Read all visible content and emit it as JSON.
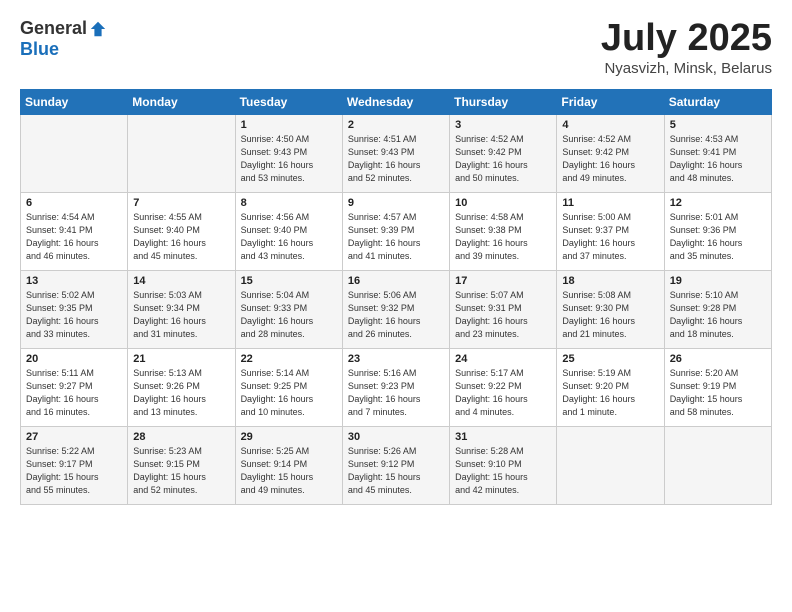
{
  "header": {
    "logo_general": "General",
    "logo_blue": "Blue",
    "title": "July 2025",
    "location": "Nyasvizh, Minsk, Belarus"
  },
  "days_of_week": [
    "Sunday",
    "Monday",
    "Tuesday",
    "Wednesday",
    "Thursday",
    "Friday",
    "Saturday"
  ],
  "weeks": [
    [
      {
        "day": "",
        "info": ""
      },
      {
        "day": "",
        "info": ""
      },
      {
        "day": "1",
        "info": "Sunrise: 4:50 AM\nSunset: 9:43 PM\nDaylight: 16 hours\nand 53 minutes."
      },
      {
        "day": "2",
        "info": "Sunrise: 4:51 AM\nSunset: 9:43 PM\nDaylight: 16 hours\nand 52 minutes."
      },
      {
        "day": "3",
        "info": "Sunrise: 4:52 AM\nSunset: 9:42 PM\nDaylight: 16 hours\nand 50 minutes."
      },
      {
        "day": "4",
        "info": "Sunrise: 4:52 AM\nSunset: 9:42 PM\nDaylight: 16 hours\nand 49 minutes."
      },
      {
        "day": "5",
        "info": "Sunrise: 4:53 AM\nSunset: 9:41 PM\nDaylight: 16 hours\nand 48 minutes."
      }
    ],
    [
      {
        "day": "6",
        "info": "Sunrise: 4:54 AM\nSunset: 9:41 PM\nDaylight: 16 hours\nand 46 minutes."
      },
      {
        "day": "7",
        "info": "Sunrise: 4:55 AM\nSunset: 9:40 PM\nDaylight: 16 hours\nand 45 minutes."
      },
      {
        "day": "8",
        "info": "Sunrise: 4:56 AM\nSunset: 9:40 PM\nDaylight: 16 hours\nand 43 minutes."
      },
      {
        "day": "9",
        "info": "Sunrise: 4:57 AM\nSunset: 9:39 PM\nDaylight: 16 hours\nand 41 minutes."
      },
      {
        "day": "10",
        "info": "Sunrise: 4:58 AM\nSunset: 9:38 PM\nDaylight: 16 hours\nand 39 minutes."
      },
      {
        "day": "11",
        "info": "Sunrise: 5:00 AM\nSunset: 9:37 PM\nDaylight: 16 hours\nand 37 minutes."
      },
      {
        "day": "12",
        "info": "Sunrise: 5:01 AM\nSunset: 9:36 PM\nDaylight: 16 hours\nand 35 minutes."
      }
    ],
    [
      {
        "day": "13",
        "info": "Sunrise: 5:02 AM\nSunset: 9:35 PM\nDaylight: 16 hours\nand 33 minutes."
      },
      {
        "day": "14",
        "info": "Sunrise: 5:03 AM\nSunset: 9:34 PM\nDaylight: 16 hours\nand 31 minutes."
      },
      {
        "day": "15",
        "info": "Sunrise: 5:04 AM\nSunset: 9:33 PM\nDaylight: 16 hours\nand 28 minutes."
      },
      {
        "day": "16",
        "info": "Sunrise: 5:06 AM\nSunset: 9:32 PM\nDaylight: 16 hours\nand 26 minutes."
      },
      {
        "day": "17",
        "info": "Sunrise: 5:07 AM\nSunset: 9:31 PM\nDaylight: 16 hours\nand 23 minutes."
      },
      {
        "day": "18",
        "info": "Sunrise: 5:08 AM\nSunset: 9:30 PM\nDaylight: 16 hours\nand 21 minutes."
      },
      {
        "day": "19",
        "info": "Sunrise: 5:10 AM\nSunset: 9:28 PM\nDaylight: 16 hours\nand 18 minutes."
      }
    ],
    [
      {
        "day": "20",
        "info": "Sunrise: 5:11 AM\nSunset: 9:27 PM\nDaylight: 16 hours\nand 16 minutes."
      },
      {
        "day": "21",
        "info": "Sunrise: 5:13 AM\nSunset: 9:26 PM\nDaylight: 16 hours\nand 13 minutes."
      },
      {
        "day": "22",
        "info": "Sunrise: 5:14 AM\nSunset: 9:25 PM\nDaylight: 16 hours\nand 10 minutes."
      },
      {
        "day": "23",
        "info": "Sunrise: 5:16 AM\nSunset: 9:23 PM\nDaylight: 16 hours\nand 7 minutes."
      },
      {
        "day": "24",
        "info": "Sunrise: 5:17 AM\nSunset: 9:22 PM\nDaylight: 16 hours\nand 4 minutes."
      },
      {
        "day": "25",
        "info": "Sunrise: 5:19 AM\nSunset: 9:20 PM\nDaylight: 16 hours\nand 1 minute."
      },
      {
        "day": "26",
        "info": "Sunrise: 5:20 AM\nSunset: 9:19 PM\nDaylight: 15 hours\nand 58 minutes."
      }
    ],
    [
      {
        "day": "27",
        "info": "Sunrise: 5:22 AM\nSunset: 9:17 PM\nDaylight: 15 hours\nand 55 minutes."
      },
      {
        "day": "28",
        "info": "Sunrise: 5:23 AM\nSunset: 9:15 PM\nDaylight: 15 hours\nand 52 minutes."
      },
      {
        "day": "29",
        "info": "Sunrise: 5:25 AM\nSunset: 9:14 PM\nDaylight: 15 hours\nand 49 minutes."
      },
      {
        "day": "30",
        "info": "Sunrise: 5:26 AM\nSunset: 9:12 PM\nDaylight: 15 hours\nand 45 minutes."
      },
      {
        "day": "31",
        "info": "Sunrise: 5:28 AM\nSunset: 9:10 PM\nDaylight: 15 hours\nand 42 minutes."
      },
      {
        "day": "",
        "info": ""
      },
      {
        "day": "",
        "info": ""
      }
    ]
  ]
}
